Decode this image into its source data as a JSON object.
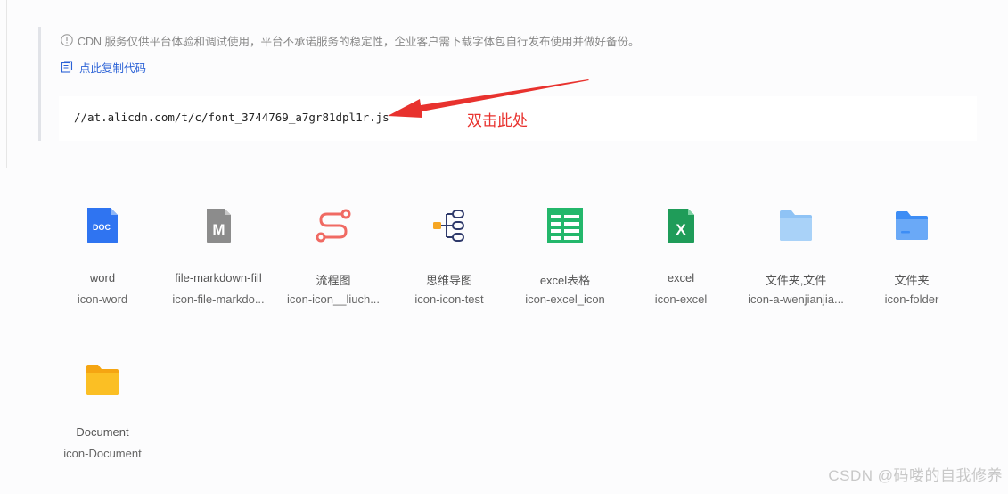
{
  "notice": {
    "text": "CDN 服务仅供平台体验和调试使用，平台不承诺服务的稳定性，企业客户需下载字体包自行发布使用并做好备份。",
    "copy_link": "点此复制代码"
  },
  "code_url": "//at.alicdn.com/t/c/font_3744769_a7gr81dpl1r.js",
  "annotation": {
    "text": "双击此处",
    "color": "#e8322e"
  },
  "icons": [
    {
      "name": "word",
      "code": "icon-word",
      "glyph": "doc-icon"
    },
    {
      "name": "file-markdown-fill",
      "code": "icon-file-markdo...",
      "glyph": "markdown-file-icon"
    },
    {
      "name": "流程图",
      "code": "icon-icon__liuch...",
      "glyph": "flowchart-icon"
    },
    {
      "name": "思维导图",
      "code": "icon-icon-test",
      "glyph": "mindmap-icon"
    },
    {
      "name": "excel表格",
      "code": "icon-excel_icon",
      "glyph": "spreadsheet-icon"
    },
    {
      "name": "excel",
      "code": "icon-excel",
      "glyph": "excel-icon"
    },
    {
      "name": "文件夹,文件",
      "code": "icon-a-wenjianjia...",
      "glyph": "folder-light-icon"
    },
    {
      "name": "文件夹",
      "code": "icon-folder",
      "glyph": "folder-blue-icon"
    },
    {
      "name": "Document",
      "code": "icon-Document",
      "glyph": "folder-yellow-icon"
    }
  ],
  "watermark": "CSDN @码喽的自我修养",
  "colors": {
    "link": "#2b62d6",
    "word_blue": "#2f74f1",
    "markdown_gray": "#8c8c8c",
    "flow_red": "#f06a63",
    "mind_navy": "#2f3a6b",
    "sheet_green": "#23b76b",
    "excel_green": "#1f9c59",
    "folder_light": "#8fc3f5",
    "folder_blue": "#3d8df5",
    "folder_yellow": "#fbbf24"
  }
}
